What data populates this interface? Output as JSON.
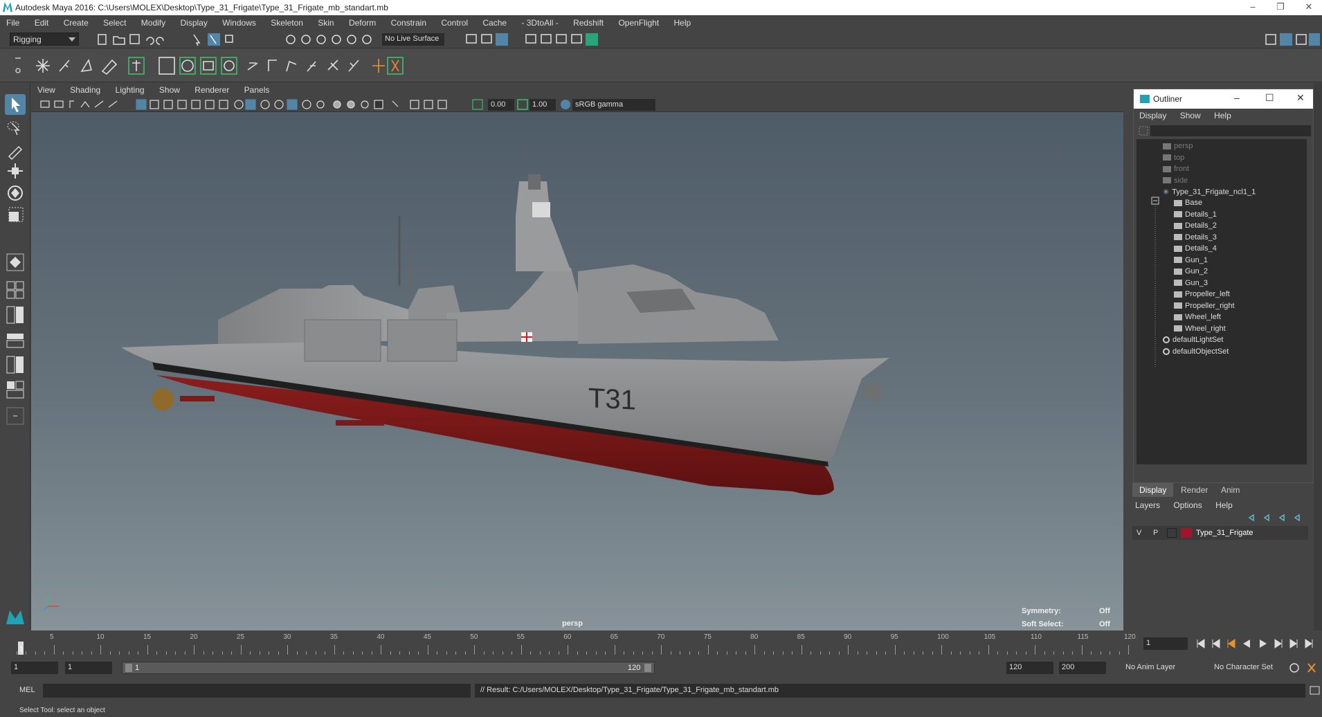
{
  "window": {
    "title": "Autodesk Maya 2016: C:\\Users\\MOLEX\\Desktop\\Type_31_Frigate\\Type_31_Frigate_mb_standart.mb"
  },
  "menubar": [
    "File",
    "Edit",
    "Create",
    "Select",
    "Modify",
    "Display",
    "Windows",
    "Skeleton",
    "Skin",
    "Deform",
    "Constrain",
    "Control",
    "Cache",
    "- 3DtoAll -",
    "Redshift",
    "OpenFlight",
    "Help"
  ],
  "statusline": {
    "mode": "Rigging",
    "live_surface": "No Live Surface"
  },
  "viewport": {
    "menu": [
      "View",
      "Shading",
      "Lighting",
      "Show",
      "Renderer",
      "Panels"
    ],
    "field_a": "0.00",
    "field_b": "1.00",
    "color_space": "sRGB gamma",
    "camera_label": "persp",
    "hud": {
      "symmetry_label": "Symmetry:",
      "symmetry_value": "Off",
      "soft_select_label": "Soft Select:",
      "soft_select_value": "Off"
    },
    "hull_marking": "T31"
  },
  "outliner": {
    "title": "Outliner",
    "menu": [
      "Display",
      "Show",
      "Help"
    ],
    "cameras": [
      "persp",
      "top",
      "front",
      "side"
    ],
    "root": "Type_31_Frigate_ncl1_1",
    "children": [
      "Base",
      "Details_1",
      "Details_2",
      "Details_3",
      "Details_4",
      "Gun_1",
      "Gun_2",
      "Gun_3",
      "Propeller_left",
      "Propeller_right",
      "Wheel_left",
      "Wheel_right"
    ],
    "sets": [
      "defaultLightSet",
      "defaultObjectSet"
    ]
  },
  "layer_editor": {
    "tabs": [
      "Display",
      "Render",
      "Anim"
    ],
    "menu": [
      "Layers",
      "Options",
      "Help"
    ],
    "layer": {
      "v": "V",
      "p": "P",
      "name": "Type_31_Frigate",
      "color": "#a0152a"
    }
  },
  "timeline": {
    "ticks": [
      "5",
      "10",
      "15",
      "20",
      "25",
      "30",
      "35",
      "40",
      "45",
      "50",
      "55",
      "60",
      "65",
      "70",
      "75",
      "80",
      "85",
      "90",
      "95",
      "100",
      "105",
      "110",
      "115",
      "120"
    ],
    "current_frame": "1",
    "first_frame_label": "1"
  },
  "range": {
    "start": "1",
    "playback_start": "1",
    "range_start": "1",
    "range_end": "120",
    "playback_end": "120",
    "end": "200",
    "anim_layer": "No Anim Layer",
    "character_set": "No Character Set"
  },
  "command": {
    "language": "MEL",
    "result": "// Result: C:/Users/MOLEX/Desktop/Type_31_Frigate/Type_31_Frigate_mb_standart.mb"
  },
  "helpline": "Select Tool: select an object",
  "colors": {
    "ui_bg": "#444444",
    "field_bg": "#2b2b2b",
    "accent": "#5285a6",
    "hull_red": "#7a1a1a"
  }
}
